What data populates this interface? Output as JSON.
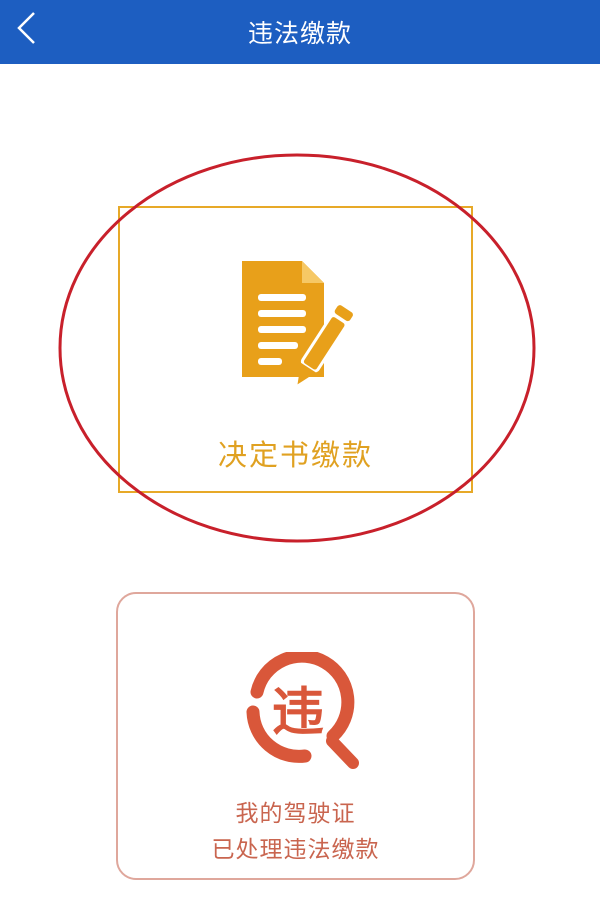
{
  "header": {
    "title": "违法缴款",
    "back_icon": "chevron-left-icon"
  },
  "cards": {
    "decision_payment": {
      "label": "决定书缴款",
      "icon": "document-pen-icon",
      "color": "#e7a928"
    },
    "my_license": {
      "line1": "我的驾驶证",
      "line2": "已处理违法缴款",
      "icon": "violation-search-icon",
      "icon_text": "违",
      "color": "#d9573a"
    }
  },
  "colors": {
    "header_bg": "#1d5ec1",
    "highlight": "#c8202b"
  }
}
